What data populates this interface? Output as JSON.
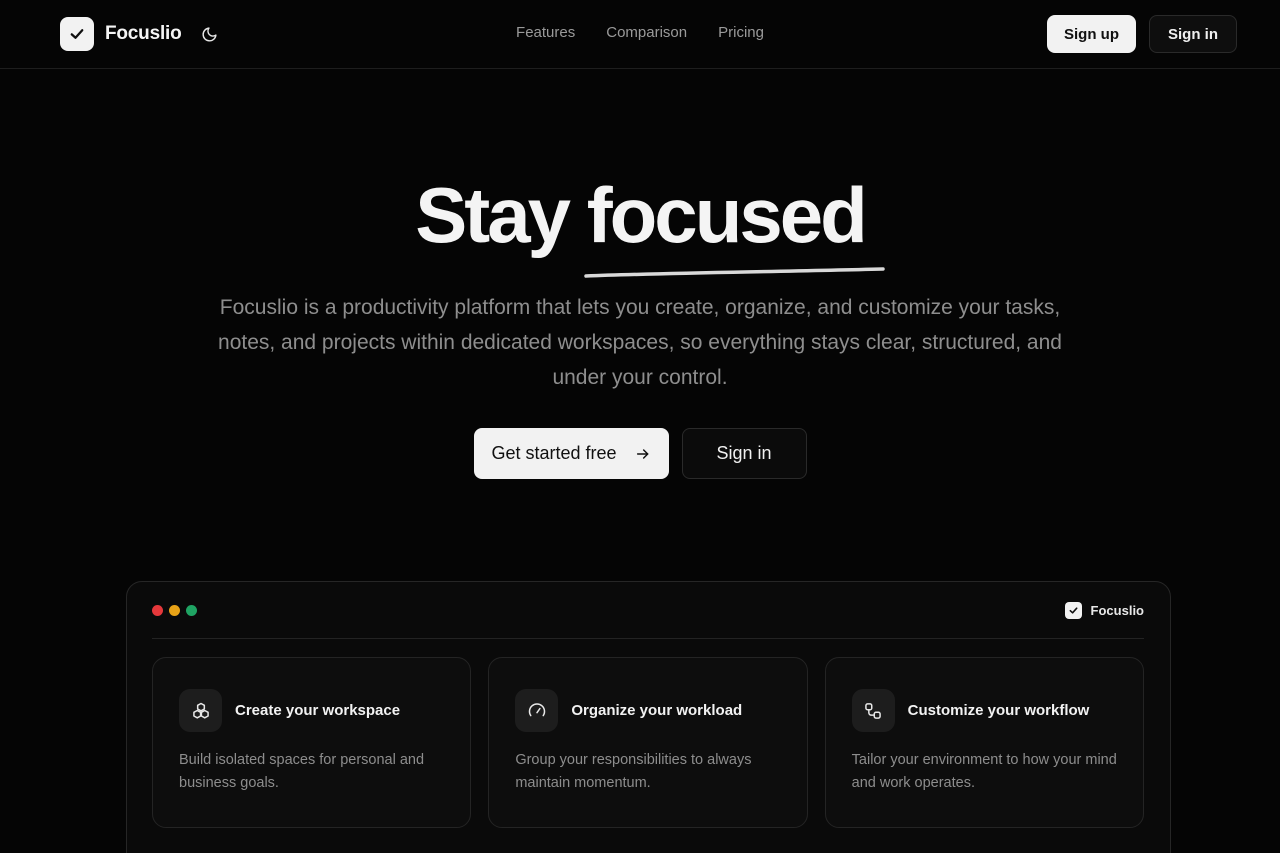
{
  "brand": {
    "name": "Focuslio"
  },
  "nav": {
    "links": [
      "Features",
      "Comparison",
      "Pricing"
    ],
    "signup": "Sign up",
    "signin": "Sign in"
  },
  "hero": {
    "title_plain": "Stay",
    "title_accent": "focused",
    "description": "Focuslio is a productivity platform that lets you create, organize, and customize your tasks, notes, and projects within dedicated workspaces, so everything stays clear, structured, and under your control.",
    "cta_primary": "Get started free",
    "cta_secondary": "Sign in"
  },
  "preview": {
    "brand": "Focuslio",
    "dot_colors": [
      "#e5383b",
      "#e8a317",
      "#1fa463"
    ],
    "cards": [
      {
        "icon": "cubes-icon",
        "title": "Create your workspace",
        "description": "Build isolated spaces for personal and business goals."
      },
      {
        "icon": "gauge-icon",
        "title": "Organize your workload",
        "description": "Group your responsibilities to always maintain momentum."
      },
      {
        "icon": "workflow-icon",
        "title": "Customize your workflow",
        "description": "Tailor your environment to how your mind and work operates."
      }
    ]
  },
  "colors": {
    "background": "#050505",
    "primary_button": "#f2f2f2",
    "muted_text": "#8e8e8e"
  }
}
